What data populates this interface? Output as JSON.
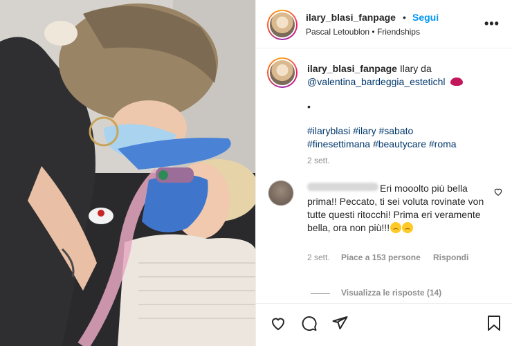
{
  "header": {
    "username": "ilary_blasi_fanpage",
    "separator": "•",
    "follow_label": "Segui",
    "location": "Pascal Letoublon • Friendships",
    "more_icon": "more-horizontal-icon"
  },
  "caption": {
    "username": "ilary_blasi_fanpage",
    "text": "Ilary da",
    "mention": "@valentina_bardeggia_estetichl",
    "emoji": "lips-emoji",
    "bullet": "•",
    "hashtags_line1": "#ilaryblasi #ilary #sabato",
    "hashtags_line2": "#finesettimana #beautycare #roma",
    "time": "2 sett."
  },
  "comment": {
    "text": "Eri mooolto più bella prima!! Peccato, ti sei voluta rovinate von tutte questi ritocchi! Prima eri veramente bella, ora non più!!!",
    "emoji": "disappointed-face-emoji",
    "time": "2 sett.",
    "likes": "Piace a 153 persone",
    "reply_label": "Rispondi",
    "view_replies": "Visualizza le risposte (14)"
  },
  "actions": {
    "like_icon": "heart-icon",
    "comment_icon": "comment-icon",
    "share_icon": "send-icon",
    "save_icon": "bookmark-icon"
  },
  "colors": {
    "accent": "#0095f6",
    "link": "#00376b",
    "muted": "#8e8e8e",
    "text": "#262626"
  }
}
